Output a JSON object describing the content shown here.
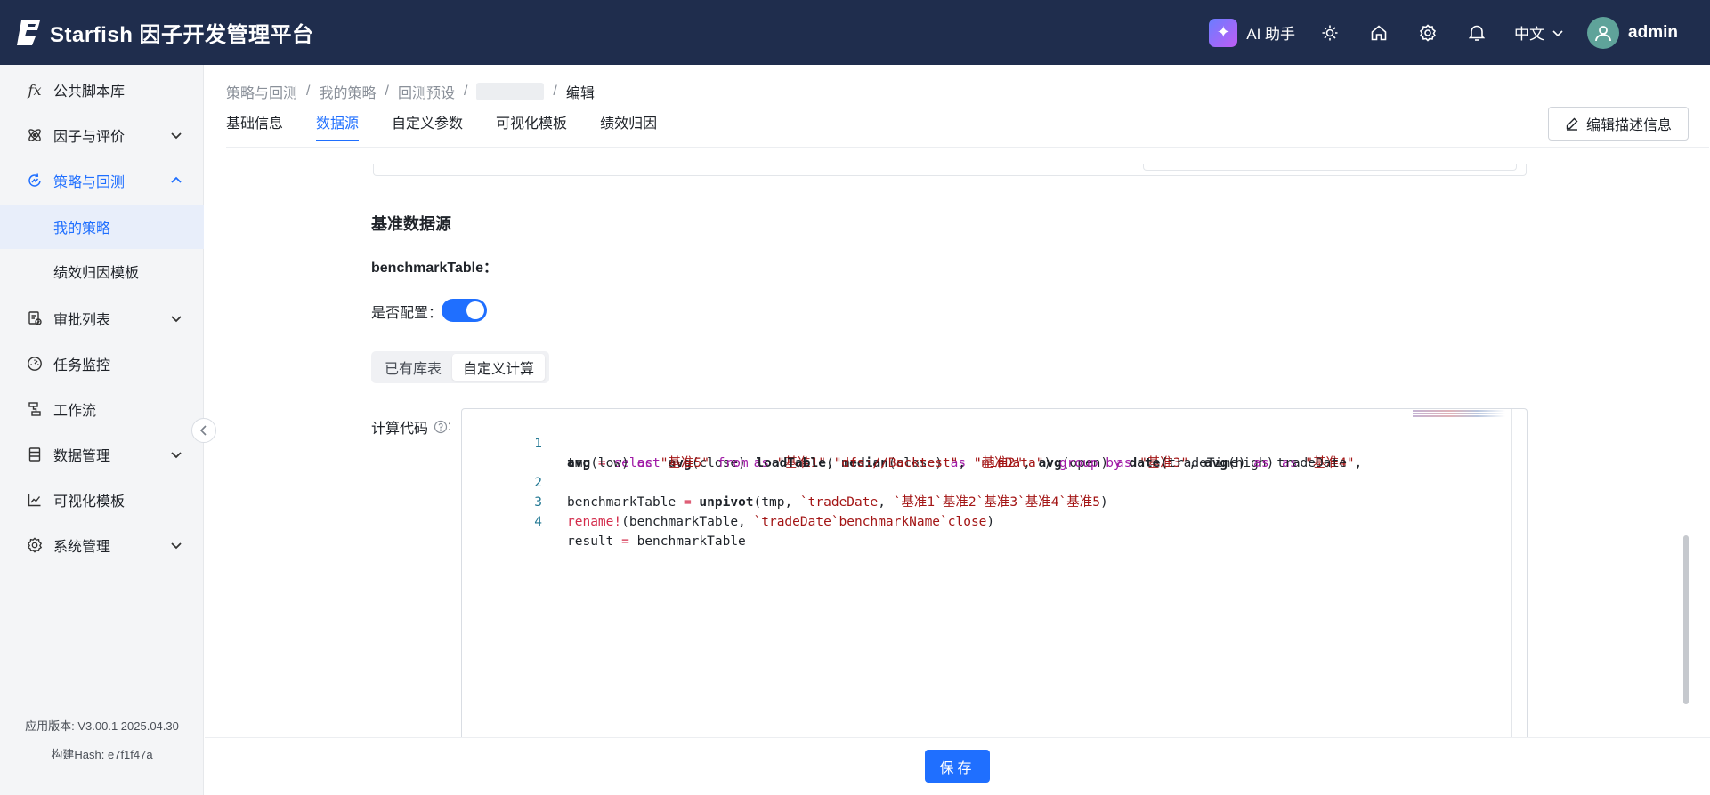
{
  "header": {
    "app_title": "Starfish 因子开发管理平台",
    "ai_label": "AI 助手",
    "lang_label": "中文",
    "username": "admin"
  },
  "sidebar": {
    "items": [
      {
        "label": "公共脚本库",
        "icon": "fx-icon"
      },
      {
        "label": "因子与评价",
        "icon": "atom-icon"
      },
      {
        "label": "策略与回测",
        "icon": "strategy-icon"
      },
      {
        "label": "我的策略"
      },
      {
        "label": "绩效归因模板"
      },
      {
        "label": "审批列表",
        "icon": "approval-icon"
      },
      {
        "label": "任务监控",
        "icon": "dashboard-icon"
      },
      {
        "label": "工作流",
        "icon": "workflow-icon"
      },
      {
        "label": "数据管理",
        "icon": "database-icon"
      },
      {
        "label": "可视化模板",
        "icon": "chart-icon"
      },
      {
        "label": "系统管理",
        "icon": "gear-icon"
      }
    ],
    "version": "应用版本: V3.00.1 2025.04.30",
    "build": "构建Hash: e7f1f47a"
  },
  "breadcrumb": [
    "策略与回测",
    "我的策略",
    "回测预设",
    "编辑"
  ],
  "tabs": [
    "基础信息",
    "数据源",
    "自定义参数",
    "可视化模板",
    "绩效归因"
  ],
  "edit_desc_label": "编辑描述信息",
  "form": {
    "section_title": "基准数据源",
    "bench_label": "benchmarkTable：",
    "configure_label": "是否配置：",
    "configure_on": true,
    "segments": [
      "已有库表",
      "自定义计算"
    ],
    "selected_segment": "自定义计算",
    "code_label": "计算代码"
  },
  "code": {
    "line_numbers": [
      "1",
      "2",
      "3",
      "4"
    ],
    "tokens": {
      "l1": [
        "tmp ",
        "=",
        " ",
        "select",
        " ",
        "avg",
        "(close) ",
        "as",
        " ",
        "\"基准1\"",
        ", ",
        "median",
        "(close) ",
        "as",
        " ",
        "\"基准2\"",
        ", ",
        "avg",
        "(open) ",
        "as",
        " ",
        "\"基准3\"",
        ", ",
        "avg",
        "(high) ",
        "as",
        " ",
        "\"基准4\"",
        ","
      ],
      "l1b": [
        "avg",
        "(low) ",
        "as",
        " ",
        "\"基准5\"",
        " ",
        "from",
        " ",
        "loadTable",
        "(",
        "\"dfs://Backtest\"",
        ", ",
        "\"minData\"",
        ") ",
        "group by",
        " ",
        "date",
        "(tradeTime) ",
        "as",
        " tradeDate"
      ],
      "l2": [
        "benchmarkTable ",
        "=",
        " ",
        "unpivot",
        "(tmp, ",
        "`tradeDate",
        ", ",
        "`基准1`基准2`基准3`基准4`基准5",
        ")"
      ],
      "l3": [
        "rename!",
        "(benchmarkTable, ",
        "`tradeDate`benchmarkName`close",
        ")"
      ],
      "l4": [
        "result ",
        "=",
        " benchmarkTable"
      ]
    }
  },
  "save_label": "保存",
  "colors": {
    "header_bg": "#1f2d4d",
    "accent": "#1f6fff",
    "sidebar_bg": "#f4f5f7",
    "keyword": "#a01aa6",
    "string": "#a31515"
  }
}
